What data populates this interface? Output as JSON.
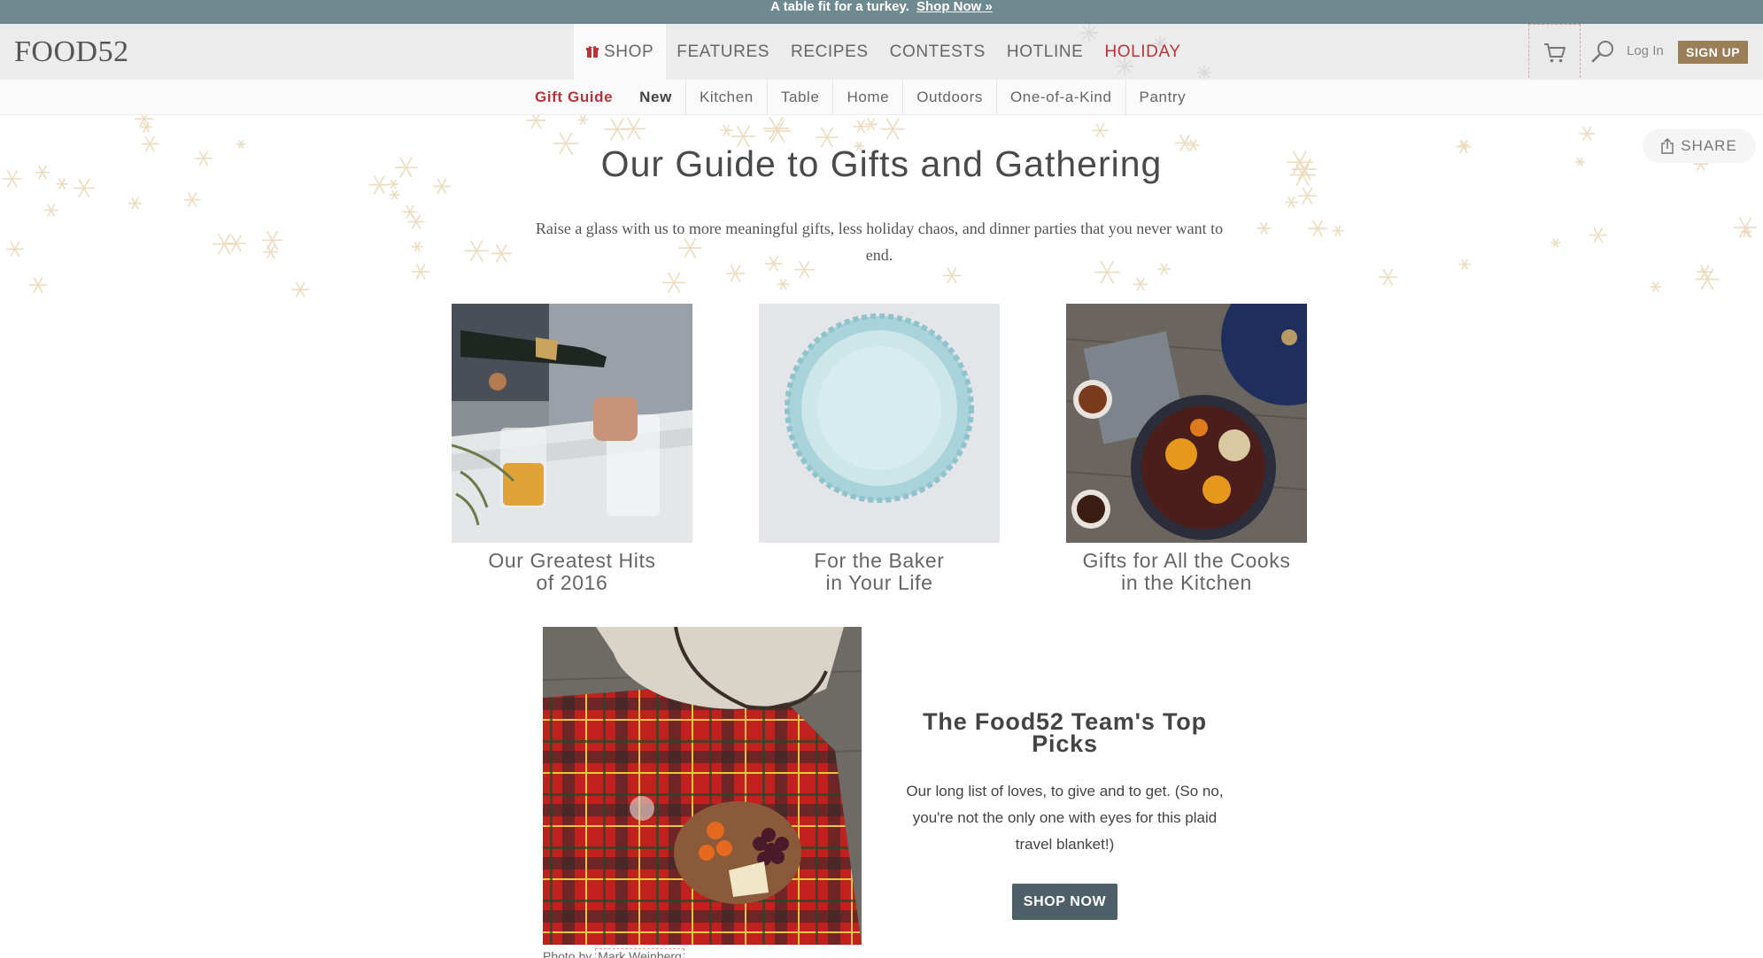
{
  "promo": {
    "text": "A table fit for a turkey.",
    "link": "Shop Now »"
  },
  "header": {
    "logo": "FOOD52",
    "nav": [
      {
        "label": "SHOP"
      },
      {
        "label": "FEATURES"
      },
      {
        "label": "RECIPES"
      },
      {
        "label": "CONTESTS"
      },
      {
        "label": "HOTLINE"
      },
      {
        "label": "HOLIDAY"
      }
    ],
    "login": "Log In",
    "signup": "SIGN UP"
  },
  "subnav": [
    "Gift Guide",
    "New",
    "Kitchen",
    "Table",
    "Home",
    "Outdoors",
    "One-of-a-Kind",
    "Pantry"
  ],
  "share": "SHARE",
  "page": {
    "title": "Our Guide to Gifts and Gathering",
    "lede": "Raise a glass with us to more meaningful gifts, less holiday chaos, and dinner parties that you never want to end."
  },
  "tiles": [
    {
      "line1": "Our Greatest Hits",
      "line2": "of 2016"
    },
    {
      "line1": "For the Baker",
      "line2": "in Your Life"
    },
    {
      "line1": "Gifts for All the Cooks",
      "line2": "in the Kitchen"
    }
  ],
  "feature": {
    "title": "The Food52 Team's Top Picks",
    "body": "Our long list of loves, to give and to get. (So no, you're not the only one with eyes for this plaid travel blanket!)",
    "button": "SHOP NOW",
    "credit_prefix": "Photo by",
    "credit_name": "Mark Weinberg"
  },
  "colors": {
    "promo": "#6e8a90",
    "holiday": "#b8343a",
    "signup": "#9a7e58",
    "button": "#4e6067"
  }
}
